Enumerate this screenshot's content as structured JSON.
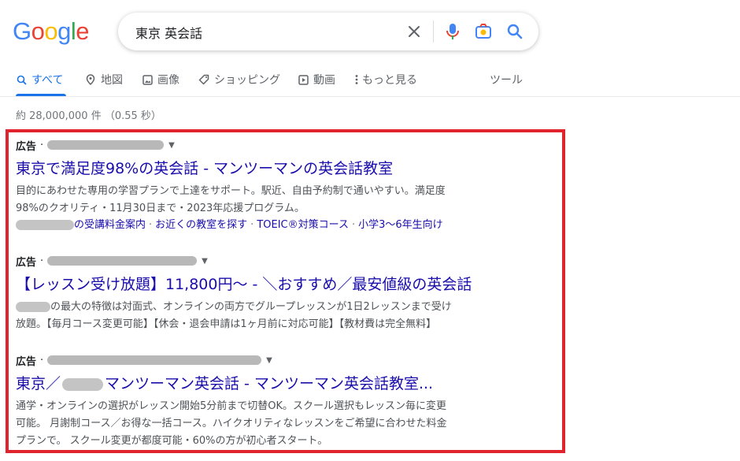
{
  "logo": {
    "letters": [
      "G",
      "o",
      "o",
      "g",
      "l",
      "e"
    ],
    "colors": [
      "#4285f4",
      "#ea4335",
      "#fbbc05",
      "#4285f4",
      "#34a853",
      "#ea4335"
    ]
  },
  "search": {
    "query": "東京 英会話"
  },
  "tabs": [
    {
      "label": "すべて",
      "icon": "search-icon",
      "active": true
    },
    {
      "label": "地図",
      "icon": "map-pin-icon"
    },
    {
      "label": "画像",
      "icon": "image-icon"
    },
    {
      "label": "ショッピング",
      "icon": "tag-icon"
    },
    {
      "label": "動画",
      "icon": "play-icon"
    },
    {
      "label": "もっと見る",
      "icon": "more-vert-icon"
    },
    {
      "label": "ツール"
    }
  ],
  "stats": "約 28,000,000 件 （0.55 秒）",
  "ads": [
    {
      "label": "広告",
      "title": "東京で満足度98%の英会話 - マンツーマンの英会話教室",
      "desc_line1": "目的にあわせた専用の学習プランで上達をサポート。駅近、自由予約制で通いやすい。満足度",
      "desc_line2": "98%のクオリティ・11月30日まで・2023年応援プログラム。",
      "sitelinks": [
        "の受講料金案内",
        "お近くの教室を探す",
        "TOEIC®対策コース",
        "小学3〜6年生向け"
      ]
    },
    {
      "label": "広告",
      "title": "【レッスン受け放題】11,800円～ - ＼おすすめ／最安値級の英会話",
      "desc_line1": "の最大の特徴は対面式、オンラインの両方でグループレッスンが1日2レッスンまで受け",
      "desc_line2": "放題。【毎月コース変更可能】【休会・退会申請は1ヶ月前に対応可能】【教材費は完全無料】"
    },
    {
      "label": "広告",
      "title_prefix": "東京／",
      "title_suffix": "マンツーマン英会話 - マンツーマン英会話教室...",
      "desc_line1": "通学・オンラインの選択がレッスン開始5分前まで切替OK。スクール選択もレッスン毎に変更",
      "desc_line2": "可能。 月謝制コース／お得な一括コース。ハイクオリティなレッスンをご希望に合わせた料金",
      "desc_line3": "プランで。 スクール変更が都度可能・60%の方が初心者スタート。"
    }
  ],
  "highlight_color": "#e0232c"
}
